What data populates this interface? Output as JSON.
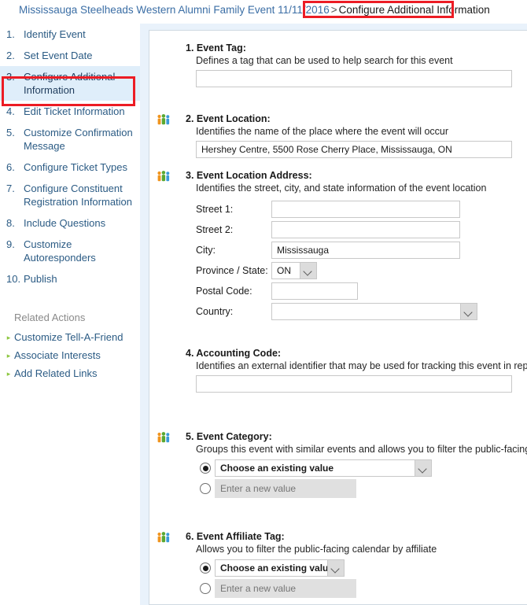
{
  "breadcrumb": {
    "trail": "Mississauga Steelheads Western Alumni Family Event 11/11/2016",
    "separator": ">",
    "current": "Configure Additional Information"
  },
  "sidebar": {
    "steps": [
      {
        "num": "1.",
        "label": "Identify Event"
      },
      {
        "num": "2.",
        "label": "Set Event Date"
      },
      {
        "num": "3.",
        "label": "Configure Additional Information"
      },
      {
        "num": "4.",
        "label": "Edit Ticket Information"
      },
      {
        "num": "5.",
        "label": "Customize Confirmation Message"
      },
      {
        "num": "6.",
        "label": "Configure Ticket Types"
      },
      {
        "num": "7.",
        "label": "Configure Constituent Registration Information"
      },
      {
        "num": "8.",
        "label": "Include Questions"
      },
      {
        "num": "9.",
        "label": "Customize Autoresponders"
      },
      {
        "num": "10.",
        "label": "Publish"
      }
    ],
    "related_actions_heading": "Related Actions",
    "related_actions": [
      {
        "label": "Customize Tell-A-Friend"
      },
      {
        "label": "Associate Interests"
      },
      {
        "label": "Add Related Links"
      }
    ]
  },
  "form": {
    "event_tag": {
      "title": "1. Event Tag:",
      "description": "Defines a tag that can be used to help search for this event",
      "value": "",
      "has_people_icon": false
    },
    "event_location": {
      "title": "2. Event Location:",
      "description": "Identifies the name of the place where the event will occur",
      "value": "Hershey Centre, 5500 Rose Cherry Place, Mississauga, ON",
      "has_people_icon": true
    },
    "event_location_address": {
      "title": "3. Event Location Address:",
      "description": "Identifies the street, city, and state information of the event location",
      "has_people_icon": true,
      "fields": [
        {
          "label": "Street 1:",
          "value": "",
          "type": "text"
        },
        {
          "label": "Street 2:",
          "value": "",
          "type": "text"
        },
        {
          "label": "City:",
          "value": "Mississauga",
          "type": "text"
        },
        {
          "label": "Province / State:",
          "value": "ON",
          "type": "select"
        },
        {
          "label": "Postal Code:",
          "value": "",
          "type": "text"
        },
        {
          "label": "Country:",
          "value": "",
          "type": "select"
        }
      ]
    },
    "accounting_code": {
      "title": "4. Accounting Code:",
      "description": "Identifies an external identifier that may be used for tracking this event in report",
      "value": "",
      "has_people_icon": false
    },
    "event_category": {
      "title": "5. Event Category:",
      "description": "Groups this event with similar events and allows you to filter the public-facing ca",
      "has_people_icon": true,
      "choose_existing_label": "Choose an existing value",
      "new_value_placeholder": "Enter a new value",
      "new_value": "",
      "selected_option": "choose-existing"
    },
    "event_affiliate_tag": {
      "title": "6. Event Affiliate Tag:",
      "description": "Allows you to filter the public-facing calendar by affiliate",
      "has_people_icon": true,
      "choose_existing_label": "Choose an existing value",
      "new_value_placeholder": "Enter a new value",
      "new_value": "",
      "selected_option": "choose-existing"
    }
  },
  "annotations": {
    "color": "#ec1c24",
    "breadcrumb_highlight": "Configure Additional Information",
    "sidebar_highlight": "Configure Additional Information"
  },
  "icons": {
    "people": "people-group-icon",
    "bullet_arrow": "▸",
    "dropdown": "chevron-down-icon"
  }
}
